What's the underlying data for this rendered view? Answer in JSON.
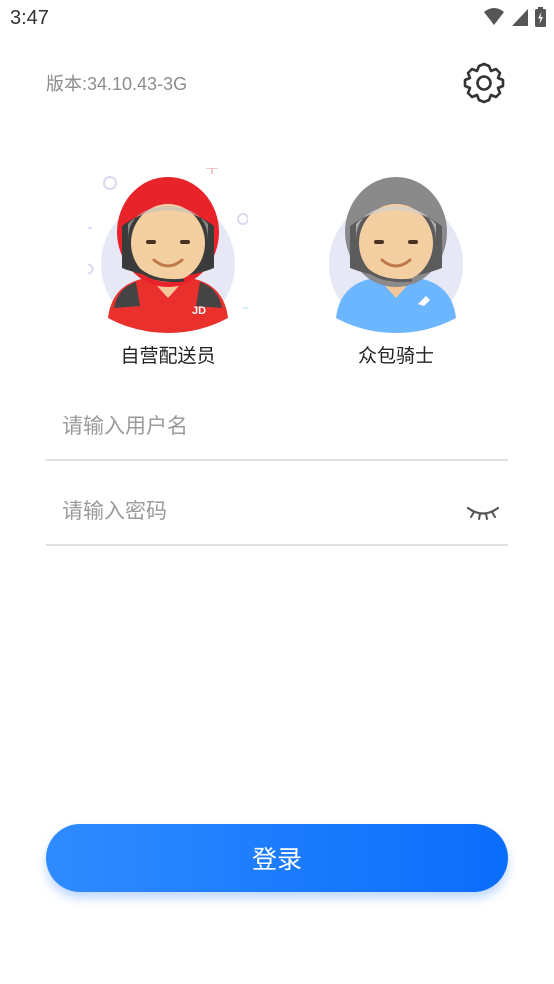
{
  "status_bar": {
    "time": "3:47"
  },
  "header": {
    "version": "版本:34.10.43-3G",
    "settings_icon": "gear-icon"
  },
  "roles": [
    {
      "label": "自营配送员",
      "badge": "JD",
      "helmet_color": "#e8232a",
      "shirt_color": "#e9302d",
      "selected": true
    },
    {
      "label": "众包骑士",
      "helmet_color": "#8a8a8a",
      "shirt_color": "#6bb6ff",
      "selected": false
    }
  ],
  "form": {
    "username": {
      "placeholder": "请输入用户名",
      "value": ""
    },
    "password": {
      "placeholder": "请输入密码",
      "value": "",
      "toggle_icon": "eye-closed-icon"
    }
  },
  "login_button": {
    "label": "登录"
  },
  "colors": {
    "accent": "#0a6dfb",
    "divider": "#e0e0e0"
  }
}
